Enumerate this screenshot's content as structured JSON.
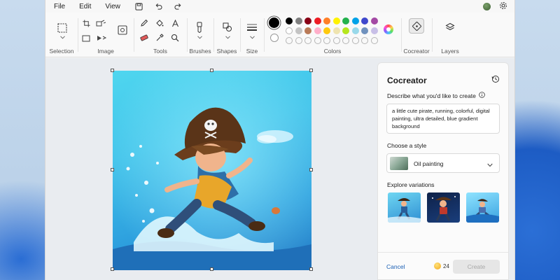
{
  "menubar": {
    "items": [
      "File",
      "Edit",
      "View"
    ]
  },
  "ribbon": {
    "groups": {
      "selection": "Selection",
      "image": "Image",
      "tools": "Tools",
      "brushes": "Brushes",
      "shapes": "Shapes",
      "size": "Size",
      "colors": "Colors",
      "cocreator": "Cocreator",
      "layers": "Layers"
    },
    "palette_top": [
      "#000000",
      "#7f7f7f",
      "#880015",
      "#ed1c24",
      "#ff7f27",
      "#fff200",
      "#22b14c",
      "#00a2e8",
      "#3f48cc",
      "#a349a4"
    ],
    "palette_mid": [
      "#ffffff",
      "#c3c3c3",
      "#b97a57",
      "#ffaec9",
      "#ffc90e",
      "#efe4b0",
      "#b5e61d",
      "#99d9ea",
      "#7092be",
      "#c8bfe7"
    ]
  },
  "panel": {
    "title": "Cocreator",
    "describe_label": "Describe what you'd like to create",
    "prompt": "a little cute pirate, running, colorful, digital painting, ultra detailed, blue gradient background",
    "style_label": "Choose a style",
    "style_value": "Oil painting",
    "variations_label": "Explore variations",
    "cancel": "Cancel",
    "credits": "24",
    "create": "Create"
  }
}
